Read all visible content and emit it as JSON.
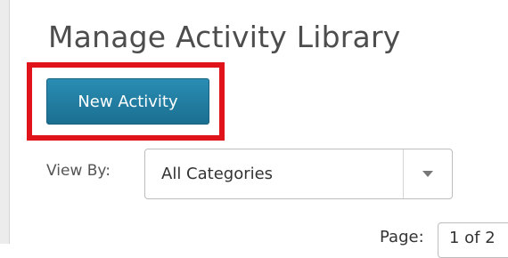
{
  "header": {
    "title": "Manage Activity Library"
  },
  "toolbar": {
    "new_activity_label": "New Activity"
  },
  "filter": {
    "view_by_label": "View By:",
    "category_selected": "All Categories"
  },
  "pagination": {
    "page_label": "Page:",
    "page_value": "1 of 2"
  },
  "colors": {
    "button_bg": "#1e7fa6",
    "highlight": "#e0131a",
    "title_text": "#4d4d4d"
  }
}
